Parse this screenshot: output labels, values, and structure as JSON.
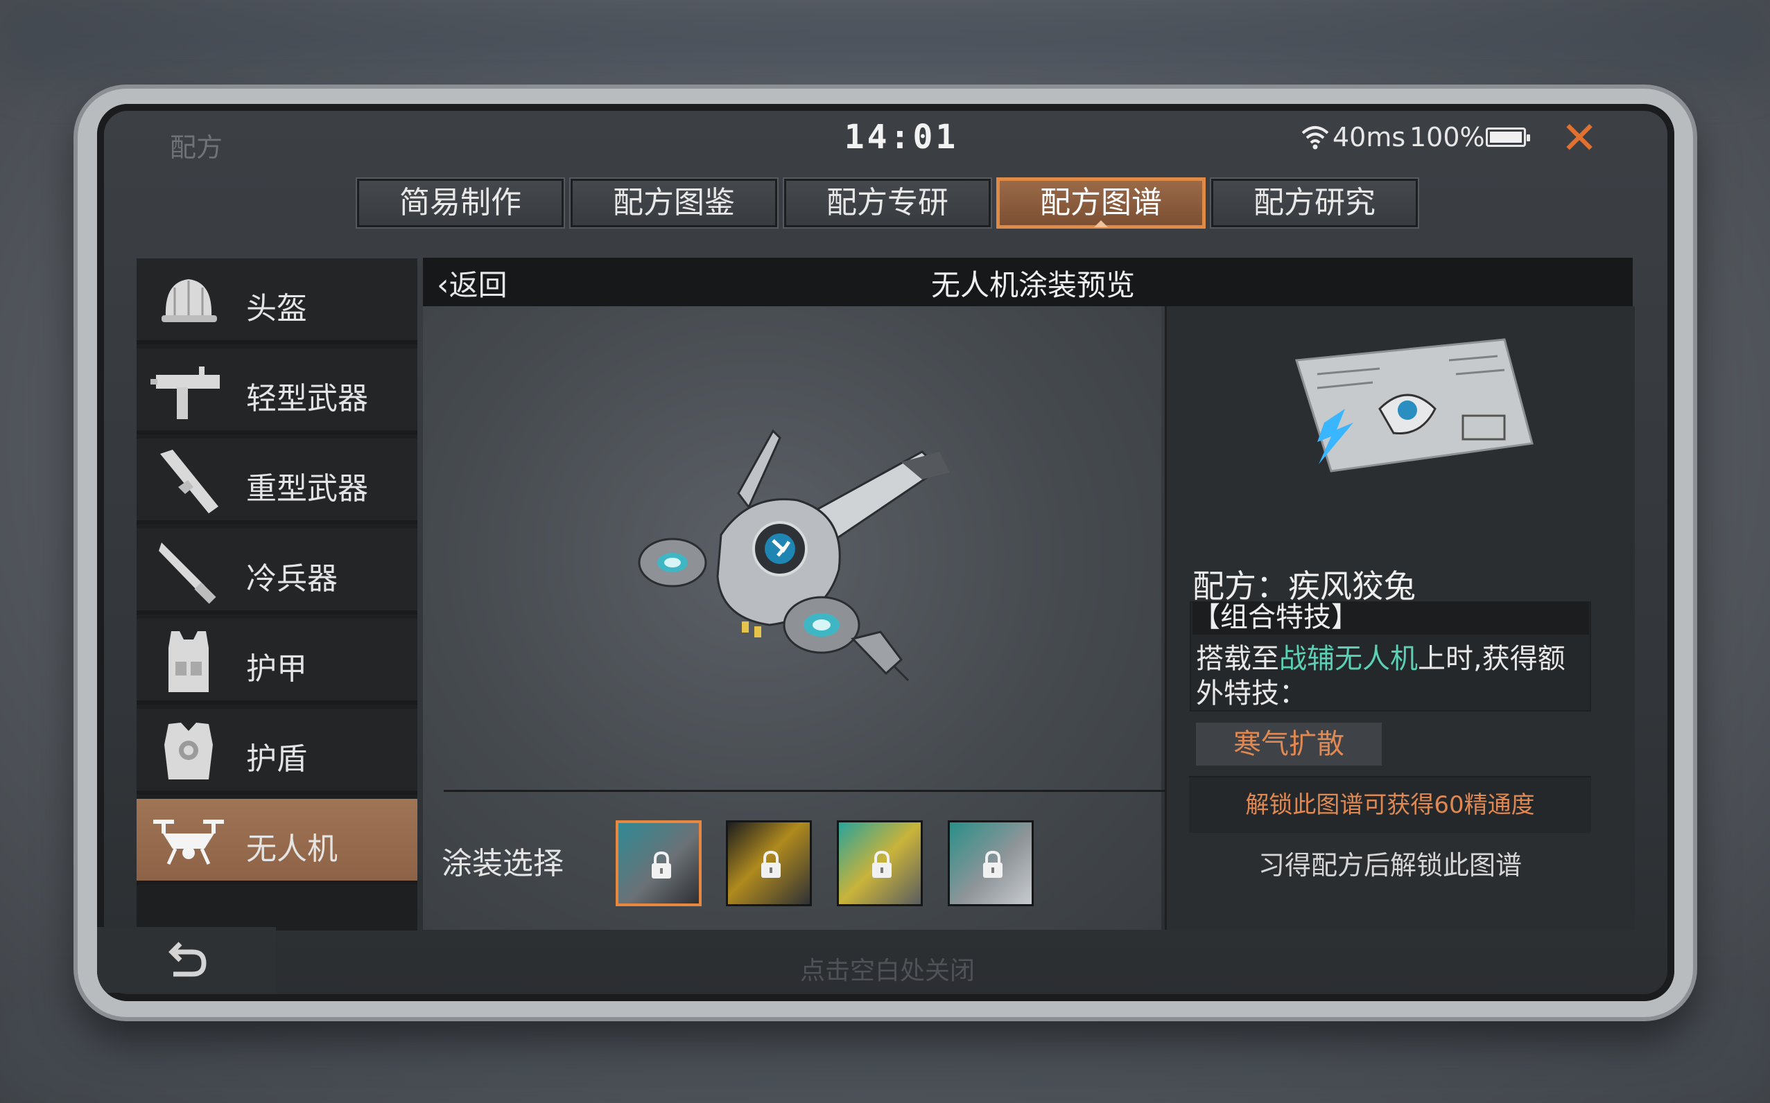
{
  "status_bar": {
    "app_label": "配方",
    "time": "14:01",
    "ping": "40ms",
    "battery": "100%",
    "battery_level": 1.0
  },
  "tabs": [
    {
      "label": "简易制作",
      "active": false
    },
    {
      "label": "配方图鉴",
      "active": false
    },
    {
      "label": "配方专研",
      "active": false
    },
    {
      "label": "配方图谱",
      "active": true
    },
    {
      "label": "配方研究",
      "active": false
    }
  ],
  "sidebar": {
    "items": [
      {
        "label": "头盔",
        "icon": "helmet-icon"
      },
      {
        "label": "轻型武器",
        "icon": "smg-icon"
      },
      {
        "label": "重型武器",
        "icon": "launcher-icon"
      },
      {
        "label": "冷兵器",
        "icon": "blade-icon"
      },
      {
        "label": "护甲",
        "icon": "armor-vest-icon"
      },
      {
        "label": "护盾",
        "icon": "shield-vest-icon"
      },
      {
        "label": "无人机",
        "icon": "drone-icon",
        "active": true
      }
    ]
  },
  "header": {
    "back_label": "返回",
    "title": "无人机涂装预览"
  },
  "preview": {
    "skin_label": "涂装选择",
    "skins": [
      {
        "name": "skin-1",
        "locked": true,
        "selected": true
      },
      {
        "name": "skin-2",
        "locked": true,
        "selected": false
      },
      {
        "name": "skin-3",
        "locked": true,
        "selected": false
      },
      {
        "name": "skin-4",
        "locked": true,
        "selected": false
      }
    ]
  },
  "info": {
    "recipe_name": "配方：疾风狡兔",
    "combo_title": "【组合特技】",
    "combo_desc_prefix": "搭载至",
    "combo_desc_highlight": "战辅无人机",
    "combo_desc_suffix": "上时,获得额外特技：",
    "skill_name": "寒气扩散",
    "unlock_reward": "解锁此图谱可获得60精通度",
    "learn_hint": "习得配方后解锁此图谱"
  },
  "dismiss_hint": "点击空白处关闭",
  "colors": {
    "accent": "#e08a47",
    "highlight": "#5bd0b5",
    "active_tab": "#8d6246"
  }
}
